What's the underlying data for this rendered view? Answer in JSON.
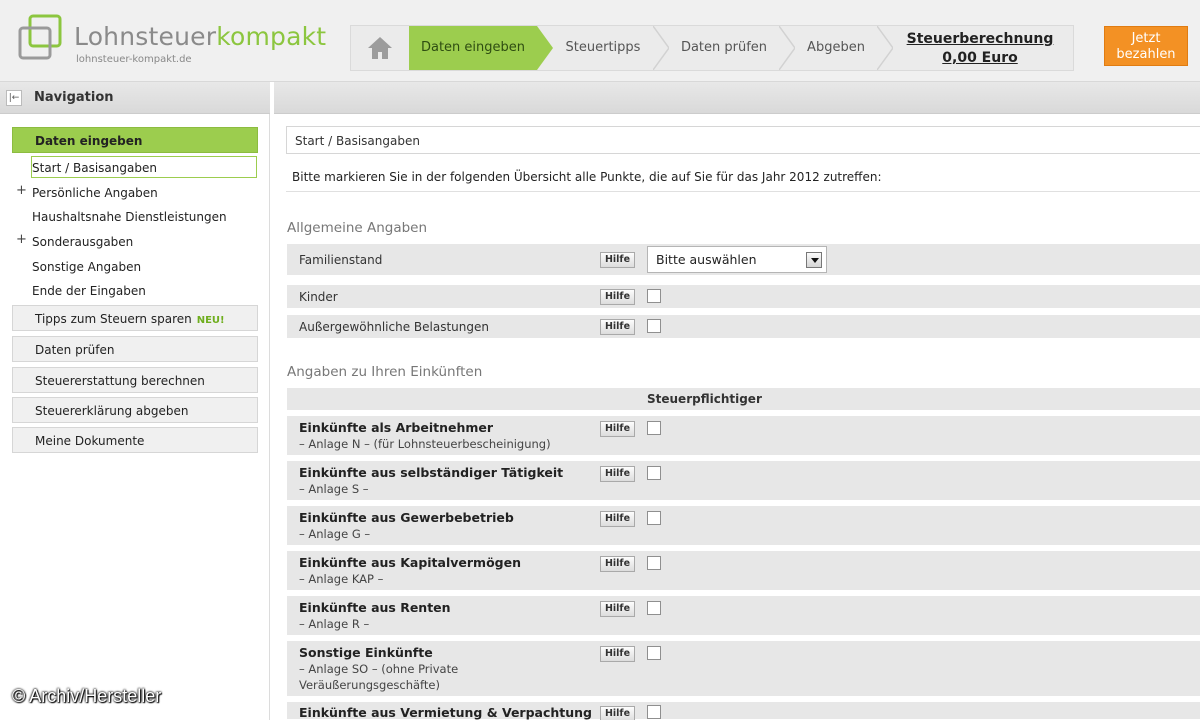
{
  "header": {
    "logo_text_part1": "Lohnsteuer",
    "logo_text_part2": "kompakt",
    "logo_url": "lohnsteuer-kompakt.de",
    "steps": [
      "Daten eingeben",
      "Steuertipps",
      "Daten prüfen",
      "Abgeben"
    ],
    "active_step": "Daten eingeben",
    "calc_label": "Steuerberechnung",
    "calc_value": "0,00 Euro",
    "pay_line1": "Jetzt",
    "pay_line2": "bezahlen"
  },
  "sidebar": {
    "title": "Navigation",
    "section_active": "Daten eingeben",
    "items": [
      {
        "label": "Start / Basisangaben",
        "expandable": false
      },
      {
        "label": "Persönliche Angaben",
        "expandable": true
      },
      {
        "label": "Haushaltsnahe Dienstleistungen",
        "expandable": false
      },
      {
        "label": "Sonderausgaben",
        "expandable": true
      },
      {
        "label": "Sonstige Angaben",
        "expandable": false
      },
      {
        "label": "Ende der Eingaben",
        "expandable": false
      }
    ],
    "sections": [
      {
        "label": "Tipps zum Steuern sparen",
        "badge": "NEU!"
      },
      {
        "label": "Daten prüfen"
      },
      {
        "label": "Steuererstattung berechnen"
      },
      {
        "label": "Steuererklärung abgeben"
      },
      {
        "label": "Meine Dokumente"
      }
    ]
  },
  "main": {
    "breadcrumb": "Start / Basisangaben",
    "intro": "Bitte markieren Sie in der folgenden Übersicht alle Punkte, die auf Sie für das Jahr 2012 zutreffen:",
    "section1_title": "Allgemeine Angaben",
    "familienstand_label": "Familienstand",
    "familienstand_select": "Bitte auswählen",
    "kinder_label": "Kinder",
    "belastungen_label": "Außergewöhnliche Belastungen",
    "section2_title": "Angaben zu Ihren Einkünften",
    "column_header": "Steuerpflichtiger",
    "hilfe_label": "Hilfe",
    "income_rows": [
      {
        "title": "Einkünfte als Arbeitnehmer",
        "sub": "– Anlage N – (für Lohnsteuerbescheinigung)"
      },
      {
        "title": "Einkünfte aus selbständiger Tätigkeit",
        "sub": "– Anlage S –"
      },
      {
        "title": "Einkünfte aus Gewerbebetrieb",
        "sub": "– Anlage G –"
      },
      {
        "title": "Einkünfte aus Kapitalvermögen",
        "sub": "– Anlage KAP –"
      },
      {
        "title": "Einkünfte aus Renten",
        "sub": "– Anlage R –"
      },
      {
        "title": "Sonstige Einkünfte",
        "sub": "– Anlage SO – (ohne Private",
        "sub2": "Veräußerungsgeschäfte)"
      },
      {
        "title": "Einkünfte aus Vermietung & Verpachtung",
        "sub": ""
      }
    ]
  },
  "watermark": "© Archiv/Hersteller",
  "colors": {
    "accent_green": "#9ccd4e",
    "pay_orange": "#f39124"
  }
}
